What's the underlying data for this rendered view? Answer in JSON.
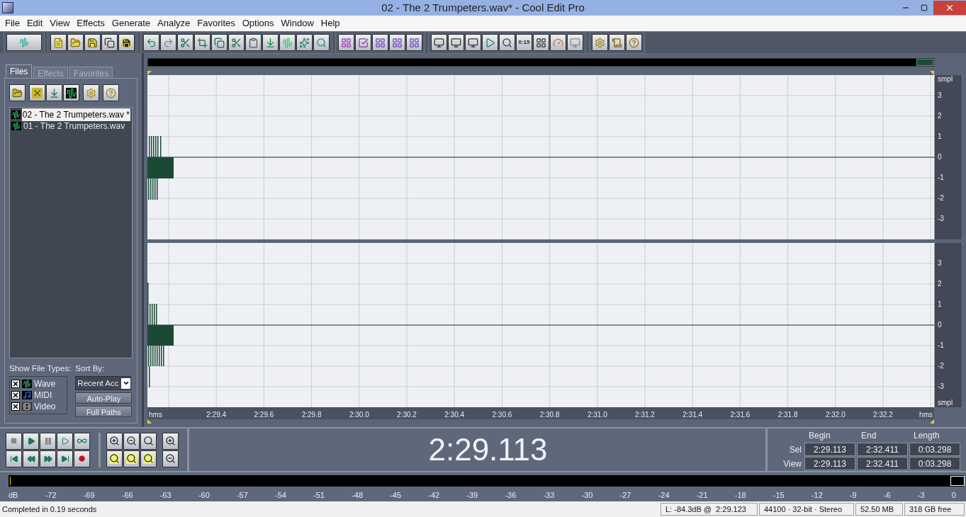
{
  "window": {
    "title": "02 - The 2 Trumpeters.wav* - Cool Edit Pro"
  },
  "menu": [
    "File",
    "Edit",
    "View",
    "Effects",
    "Generate",
    "Analyze",
    "Favorites",
    "Options",
    "Window",
    "Help"
  ],
  "toolbar": {
    "time_button_label": "0:15"
  },
  "file_panel": {
    "tabs": [
      {
        "label": "Files",
        "selected": true
      },
      {
        "label": "Effects",
        "selected": false
      },
      {
        "label": "Favorites",
        "selected": false
      }
    ],
    "files": [
      {
        "name": "02 - The 2 Trumpeters.wav *",
        "selected": true
      },
      {
        "name": "01 - The 2 Trumpeters.wav",
        "selected": false
      }
    ],
    "show_file_types_label": "Show File Types:",
    "file_types": [
      {
        "label": "Wave",
        "checked": true,
        "kind": "wave"
      },
      {
        "label": "MIDI",
        "checked": true,
        "kind": "midi"
      },
      {
        "label": "Video",
        "checked": true,
        "kind": "video"
      }
    ],
    "sort_by_label": "Sort By:",
    "sort_by": "Recent Acc",
    "buttons": [
      "Auto-Play",
      "Full Paths"
    ]
  },
  "waveform": {
    "channels": [
      {
        "unit_label_top": "smpl",
        "values": [
          "3",
          "2",
          "1",
          "0",
          "-1",
          "-2",
          "-3"
        ]
      },
      {
        "values": [
          "3",
          "2",
          "1",
          "0",
          "-1",
          "-2",
          "-3"
        ],
        "unit_label_bottom": "smpl"
      }
    ],
    "time_unit_labels": [
      "hms",
      "hms"
    ],
    "time_labels": [
      "2:29.4",
      "2:29.6",
      "2:29.8",
      "2:30.0",
      "2:30.2",
      "2:30.4",
      "2:30.6",
      "2:30.8",
      "2:31.0",
      "2:31.2",
      "2:31.4",
      "2:31.6",
      "2:31.8",
      "2:32.0",
      "2:32.2"
    ]
  },
  "time_display": "2:29.113",
  "selection": {
    "columns": [
      "Begin",
      "End",
      "Length"
    ],
    "rows": [
      {
        "label": "Sel",
        "values": [
          "2:29.113",
          "2:32.411",
          "0:03.298"
        ]
      },
      {
        "label": "View",
        "values": [
          "2:29.113",
          "2:32.411",
          "0:03.298"
        ]
      }
    ]
  },
  "level_meter": {
    "scale": [
      "dB",
      "-72",
      "-69",
      "-66",
      "-63",
      "-60",
      "-57",
      "-54",
      "-51",
      "-48",
      "-45",
      "-42",
      "-39",
      "-36",
      "-33",
      "-30",
      "-27",
      "-24",
      "-21",
      "-18",
      "-15",
      "-12",
      "-9",
      "-6",
      "-3",
      "0"
    ]
  },
  "status_bar": [
    "Completed in 0.19 seconds",
    "L: -84.3dB @  2:29.123",
    "44100 · 32-bit · Stereo",
    "52.50 MB",
    "318 GB free"
  ]
}
